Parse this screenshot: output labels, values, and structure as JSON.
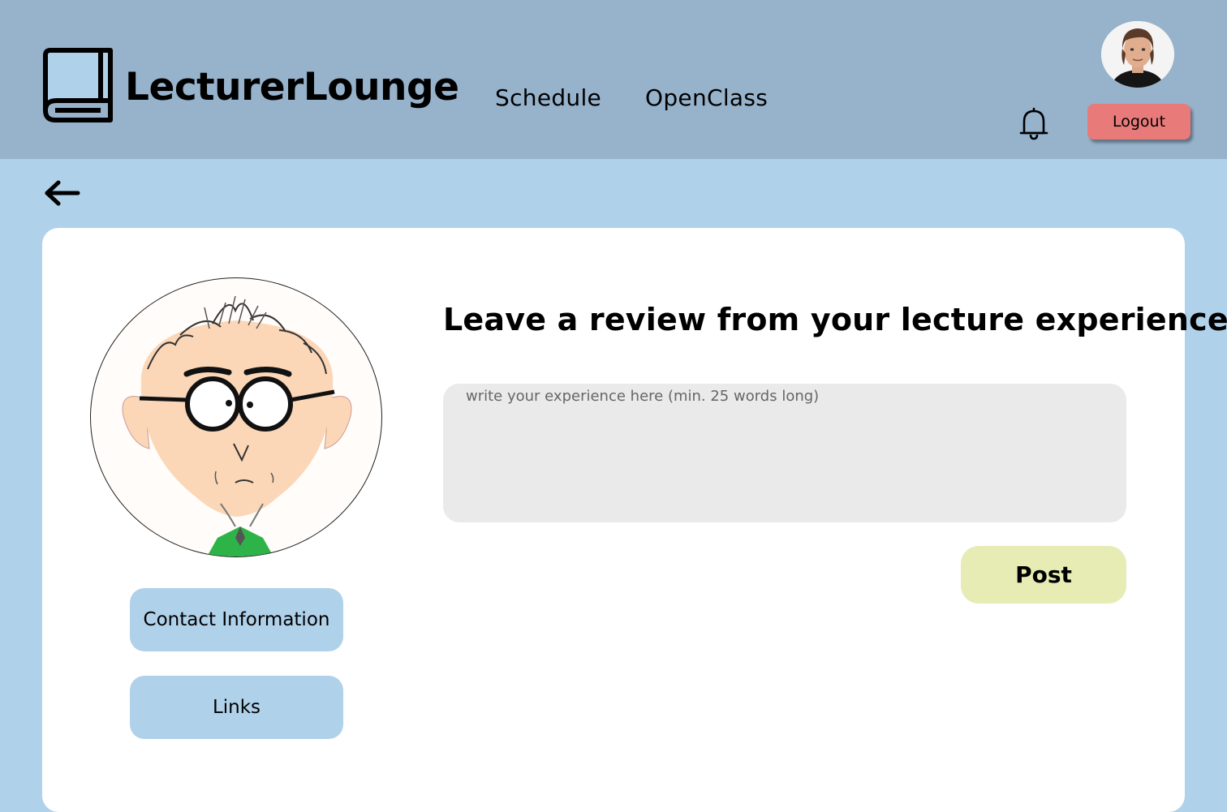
{
  "header": {
    "brand": "LecturerLounge",
    "nav": [
      {
        "label": "Schedule"
      },
      {
        "label": "OpenClass"
      }
    ],
    "logout_label": "Logout"
  },
  "icons": {
    "logo": "book-icon",
    "notifications": "bell-icon",
    "back": "arrow-left-icon"
  },
  "lecturer": {
    "contact_label": "Contact Information",
    "links_label": "Links"
  },
  "review": {
    "title": "Leave a review from your lecture experience",
    "placeholder": "write your experience here (min. 25 words long)",
    "post_label": "Post"
  },
  "colors": {
    "header_bg": "#97b2cb",
    "page_bg": "#b0d1ea",
    "logout": "#e97a7a",
    "post": "#e7ebb4",
    "input_bg": "#eaeaea"
  }
}
